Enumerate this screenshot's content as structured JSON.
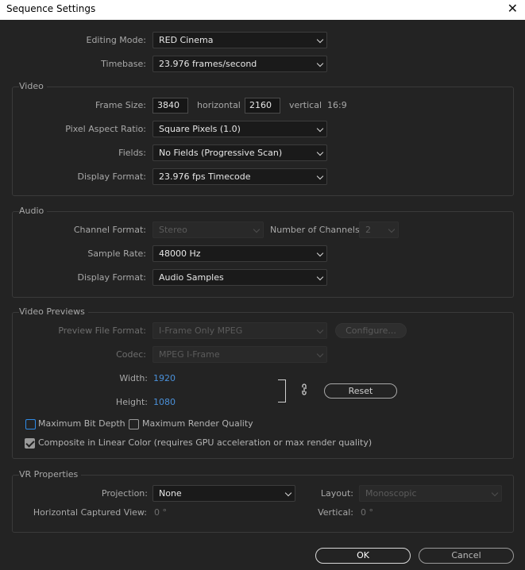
{
  "window": {
    "title": "Sequence Settings",
    "close_glyph": "✕"
  },
  "top": {
    "editing_mode_label": "Editing Mode:",
    "editing_mode_value": "RED Cinema",
    "timebase_label": "Timebase:",
    "timebase_value": "23.976  frames/second"
  },
  "video": {
    "group_label": "Video",
    "frame_size_label": "Frame Size:",
    "frame_width": "3840",
    "horizontal_label": "horizontal",
    "frame_height": "2160",
    "vertical_label": "vertical",
    "aspect_ratio": "16:9",
    "pixel_aspect_label": "Pixel Aspect Ratio:",
    "pixel_aspect_value": "Square Pixels (1.0)",
    "fields_label": "Fields:",
    "fields_value": "No Fields (Progressive Scan)",
    "display_format_label": "Display Format:",
    "display_format_value": "23.976 fps Timecode"
  },
  "audio": {
    "group_label": "Audio",
    "channel_format_label": "Channel Format:",
    "channel_format_value": "Stereo",
    "num_channels_label": "Number of Channels:",
    "num_channels_value": "2",
    "sample_rate_label": "Sample Rate:",
    "sample_rate_value": "48000 Hz",
    "display_format_label": "Display Format:",
    "display_format_value": "Audio Samples"
  },
  "previews": {
    "group_label": "Video Previews",
    "file_format_label": "Preview File Format:",
    "file_format_value": "I-Frame Only MPEG",
    "configure_label": "Configure...",
    "codec_label": "Codec:",
    "codec_value": "MPEG I-Frame",
    "width_label": "Width:",
    "width_value": "1920",
    "height_label": "Height:",
    "height_value": "1080",
    "reset_label": "Reset",
    "max_bit_depth_label": "Maximum Bit Depth",
    "max_bit_depth_checked": false,
    "max_render_quality_label": "Maximum Render Quality",
    "max_render_quality_checked": false,
    "linear_color_label": "Composite in Linear Color (requires GPU acceleration or max render quality)",
    "linear_color_checked": true
  },
  "vr": {
    "group_label": "VR Properties",
    "projection_label": "Projection:",
    "projection_value": "None",
    "layout_label": "Layout:",
    "layout_value": "Monoscopic",
    "h_captured_label": "Horizontal Captured View:",
    "h_captured_value": "0 °",
    "vertical_label": "Vertical:",
    "vertical_value": "0 °"
  },
  "footer": {
    "ok_label": "OK",
    "cancel_label": "Cancel"
  },
  "colors": {
    "accent_blue": "#2f8ce8",
    "link_blue": "#4a90d9",
    "background": "#232323"
  },
  "icons": {
    "dropdown": "chevron-down-icon",
    "link": "link-chain-icon",
    "close": "close-icon"
  }
}
